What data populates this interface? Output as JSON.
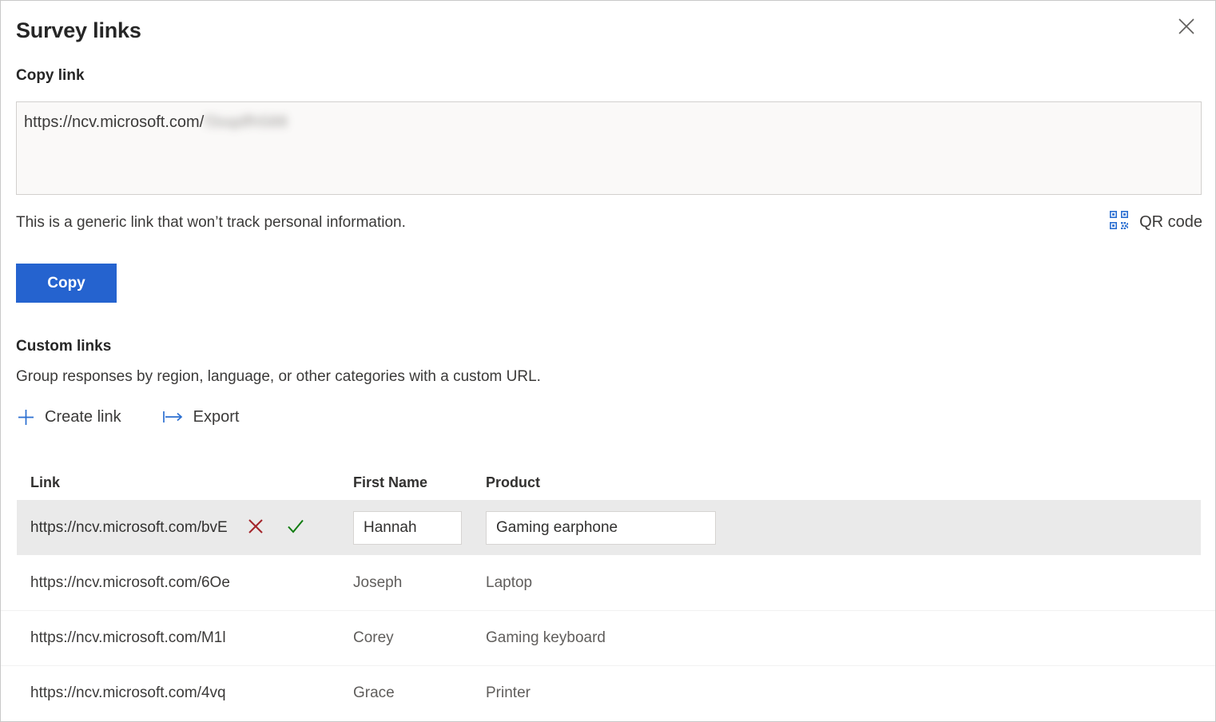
{
  "panel": {
    "title": "Survey links",
    "close_icon": "close-icon"
  },
  "copy_link": {
    "label": "Copy link",
    "url_visible": "https://ncv.microsoft.com/",
    "url_redacted": "f3sqdfh588",
    "note": "This is a generic link that won’t track personal information.",
    "qr_label": "QR code",
    "qr_icon": "qr-code-icon",
    "copy_button": "Copy"
  },
  "custom_links": {
    "title": "Custom links",
    "description": "Group responses by region, language, or other categories with a custom URL.",
    "commands": [
      {
        "label": "Create link",
        "icon": "plus-icon",
        "name": "create-link-button"
      },
      {
        "label": "Export",
        "icon": "export-icon",
        "name": "export-button"
      }
    ],
    "table": {
      "headers": [
        "Link",
        "First Name",
        "Product"
      ],
      "rows": [
        {
          "link": "https://ncv.microsoft.com/bvE",
          "first_name": "Hannah",
          "product": "Gaming earphone",
          "editing": true,
          "cancel_icon": "cancel-x-icon",
          "confirm_icon": "confirm-check-icon"
        },
        {
          "link": "https://ncv.microsoft.com/6Oe",
          "first_name": "Joseph",
          "product": "Laptop",
          "editing": false
        },
        {
          "link": "https://ncv.microsoft.com/M1l",
          "first_name": "Corey",
          "product": "Gaming keyboard",
          "editing": false
        },
        {
          "link": "https://ncv.microsoft.com/4vq",
          "first_name": "Grace",
          "product": "Printer",
          "editing": false
        }
      ]
    }
  },
  "colors": {
    "accent_blue": "#2563cf",
    "icon_blue": "#2b6fd1",
    "cancel_red": "#a4262c",
    "confirm_green": "#107c10",
    "selected_row": "#eaeaea"
  }
}
